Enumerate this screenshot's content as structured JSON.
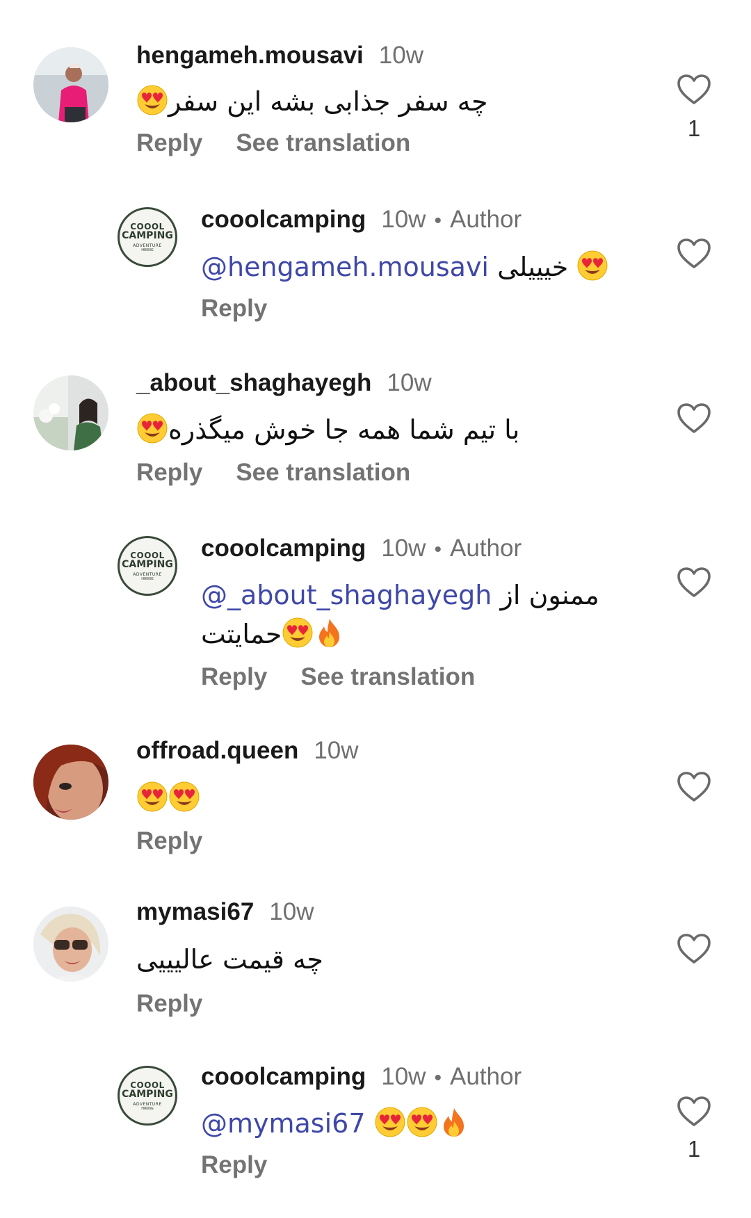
{
  "comments": [
    {
      "username": "hengameh.mousavi",
      "time": "10w",
      "text": "چه سفر جذابی بشه این سفر",
      "emojis": [
        "heart-eyes-emoji"
      ],
      "actions": {
        "reply": "Reply",
        "translate": "See translation"
      },
      "likes": "1"
    },
    {
      "username": "cooolcamping",
      "time": "10w",
      "author_dot": "•",
      "author_label": "Author",
      "mention": "@hengameh.mousavi",
      "text": "خیییلی",
      "emojis": [
        "heart-eyes-emoji"
      ],
      "actions": {
        "reply": "Reply"
      }
    },
    {
      "username": "_about_shaghayegh",
      "time": "10w",
      "text": "با تیم شما همه جا خوش میگذره",
      "emojis": [
        "heart-eyes-emoji"
      ],
      "actions": {
        "reply": "Reply",
        "translate": "See translation"
      }
    },
    {
      "username": "cooolcamping",
      "time": "10w",
      "author_dot": "•",
      "author_label": "Author",
      "mention": "@_about_shaghayegh",
      "text": "ممنون از",
      "text_line2": "حمایتت",
      "emojis": [
        "heart-eyes-emoji",
        "fire-emoji"
      ],
      "actions": {
        "reply": "Reply",
        "translate": "See translation"
      }
    },
    {
      "username": "offroad.queen",
      "time": "10w",
      "emojis": [
        "heart-eyes-emoji",
        "heart-eyes-emoji"
      ],
      "actions": {
        "reply": "Reply"
      }
    },
    {
      "username": "mymasi67",
      "time": "10w",
      "text": "چه قیمت عالیییی",
      "actions": {
        "reply": "Reply"
      }
    },
    {
      "username": "cooolcamping",
      "time": "10w",
      "author_dot": "•",
      "author_label": "Author",
      "mention": "@mymasi67",
      "emojis": [
        "heart-eyes-emoji",
        "heart-eyes-emoji",
        "fire-emoji"
      ],
      "actions": {
        "reply": "Reply"
      },
      "likes": "1"
    }
  ],
  "logo": {
    "line1": "COOOL",
    "line2": "CAMPING",
    "line3": "ADVENTURE",
    "line4": "HIKING"
  },
  "colors": {
    "mention": "#3f48a8",
    "muted": "#737373",
    "text": "#111111"
  }
}
